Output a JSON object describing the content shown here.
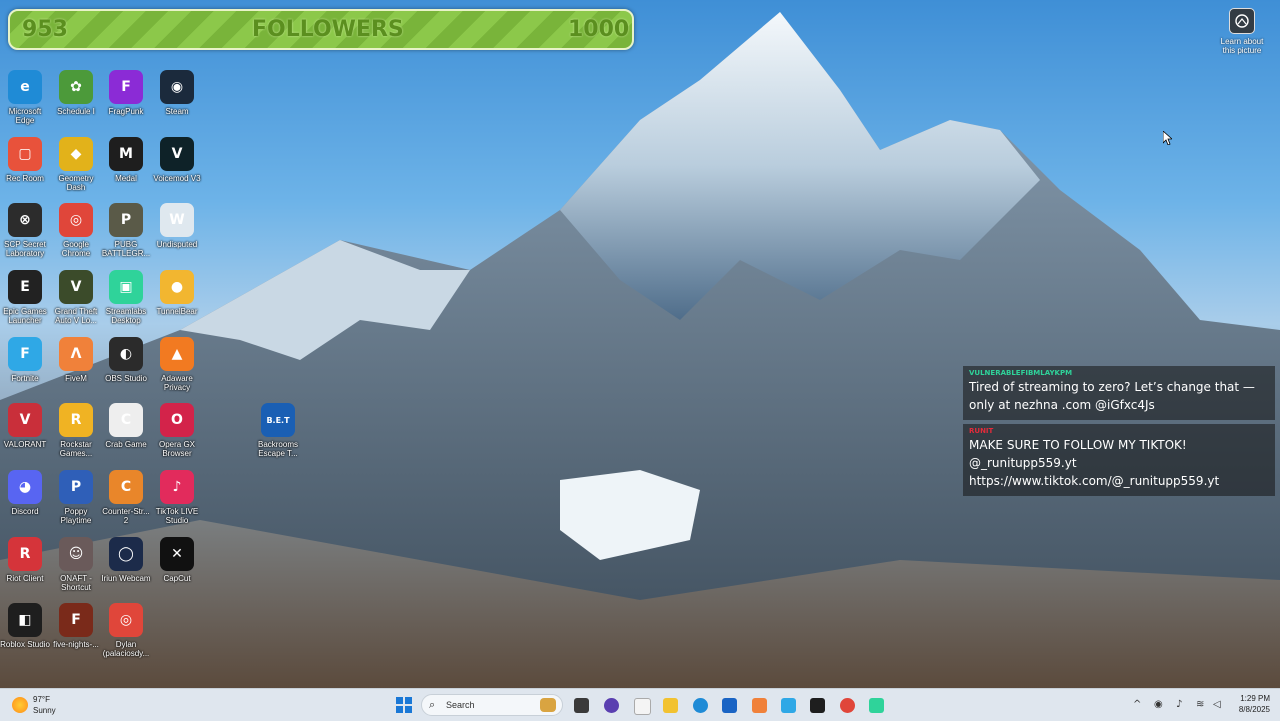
{
  "followers_goal": {
    "current": "953",
    "label": "FOLLOWERS",
    "target": "1000"
  },
  "desktop_icons": [
    {
      "name": "Microsoft Edge",
      "label": "Microsoft Edge",
      "color": "#1f8bd6",
      "glyph": "e"
    },
    {
      "name": "Schedule I",
      "label": "Schedule I",
      "color": "#4c9a3a",
      "glyph": "✿"
    },
    {
      "name": "FragPunk",
      "label": "FragPunk",
      "color": "#8b2bd6",
      "glyph": "F"
    },
    {
      "name": "Steam",
      "label": "Steam",
      "color": "#1b2a3c",
      "glyph": "◉"
    },
    {
      "name": "Rec Room",
      "label": "Rec Room",
      "color": "#e8523b",
      "glyph": "▢"
    },
    {
      "name": "Geometry Dash",
      "label": "Geometry Dash",
      "color": "#e2b21a",
      "glyph": "◆"
    },
    {
      "name": "Medal",
      "label": "Medal",
      "color": "#1e1e1e",
      "glyph": "M"
    },
    {
      "name": "Voicemod V3",
      "label": "Voicemod V3",
      "color": "#0e2228",
      "glyph": "V"
    },
    {
      "name": "SCP Secret Laboratory",
      "label": "SCP Secret Laboratory",
      "color": "#2c2c2c",
      "glyph": "⊗"
    },
    {
      "name": "Google Chrome",
      "label": "Google Chrome",
      "color": "#e0463a",
      "glyph": "◎"
    },
    {
      "name": "PUBG BATTLEGROUNDS",
      "label": "PUBG BATTLEGR...",
      "color": "#5a5a48",
      "glyph": "P"
    },
    {
      "name": "Undisputed",
      "label": "Undisputed",
      "color": "#dfe8ef",
      "glyph": "W"
    },
    {
      "name": "Epic Games Launcher",
      "label": "Epic Games Launcher",
      "color": "#222222",
      "glyph": "E"
    },
    {
      "name": "Grand Theft Auto V",
      "label": "Grand Theft Auto V Lo...",
      "color": "#3b4b2a",
      "glyph": "V"
    },
    {
      "name": "Streamlabs Desktop",
      "label": "Streamlabs Desktop",
      "color": "#2fd39a",
      "glyph": "▣"
    },
    {
      "name": "TunnelBear",
      "label": "TunnelBear",
      "color": "#f2b630",
      "glyph": "●"
    },
    {
      "name": "Fortnite",
      "label": "Fortnite",
      "color": "#2fa8e6",
      "glyph": "F"
    },
    {
      "name": "FiveM",
      "label": "FiveM",
      "color": "#f0813a",
      "glyph": "Λ"
    },
    {
      "name": "OBS Studio",
      "label": "OBS Studio",
      "color": "#2b2b2b",
      "glyph": "◐"
    },
    {
      "name": "Adaware Privacy",
      "label": "Adaware Privacy",
      "color": "#f27a21",
      "glyph": "▲"
    },
    {
      "name": "VALORANT",
      "label": "VALORANT",
      "color": "#c92f3a",
      "glyph": "V"
    },
    {
      "name": "Rockstar Games",
      "label": "Rockstar Games...",
      "color": "#f0b323",
      "glyph": "R"
    },
    {
      "name": "Crab Game",
      "label": "Crab Game",
      "color": "#eeeeee",
      "glyph": "C"
    },
    {
      "name": "Opera GX Browser",
      "label": "Opera GX Browser",
      "color": "#d3234a",
      "glyph": "O"
    },
    {
      "name": "Discord",
      "label": "Discord",
      "color": "#5865f2",
      "glyph": "◕"
    },
    {
      "name": "Poppy Playtime",
      "label": "Poppy Playtime",
      "color": "#2f5fb8",
      "glyph": "P"
    },
    {
      "name": "Counter-Strike 2",
      "label": "Counter-Str... 2",
      "color": "#e9862a",
      "glyph": "C"
    },
    {
      "name": "TikTok LIVE Studio",
      "label": "TikTok LIVE Studio",
      "color": "#e22b5c",
      "glyph": "♪"
    },
    {
      "name": "Riot Client",
      "label": "Riot Client",
      "color": "#d5343a",
      "glyph": "R"
    },
    {
      "name": "ONAFT - Shortcut",
      "label": "ONAFT - Shortcut",
      "color": "#6a5a5a",
      "glyph": "☺"
    },
    {
      "name": "Iriun Webcam",
      "label": "Iriun Webcam",
      "color": "#1c2b4a",
      "glyph": "◯"
    },
    {
      "name": "CapCut",
      "label": "CapCut",
      "color": "#111111",
      "glyph": "✕"
    },
    {
      "name": "Roblox Studio",
      "label": "Roblox Studio",
      "color": "#1e1e1e",
      "glyph": "◧"
    },
    {
      "name": "five-nights-",
      "label": "five-nights-...",
      "color": "#7a2a1a",
      "glyph": "F"
    },
    {
      "name": "Dylan (palaciosdy)",
      "label": "Dylan (palaciosdy...",
      "color": "#e0463a",
      "glyph": "◎"
    },
    {
      "name": "Backrooms Escape",
      "label": "Backrooms Escape T...",
      "color": "#1a5fb4",
      "glyph": "B.E.T"
    }
  ],
  "learn_about": {
    "label": "Learn about this picture"
  },
  "chat": [
    {
      "user": "VULNERABLEFIBMLAYKPM",
      "user_color": "#2fd39a",
      "text": "Tired of streaming to zero? Let’s change that — only at nezhna .com @iGfxc4Js"
    },
    {
      "user": "RUNIT",
      "user_color": "#e22b3a",
      "text": "MAKE SURE TO FOLLOW MY TIKTOK! @_runitupp559.yt https://www.tiktok.com/@_runitupp559.yt"
    }
  ],
  "taskbar": {
    "weather_temp": "97°F",
    "weather_desc": "Sunny",
    "search_placeholder": "Search",
    "time": "1:29 PM",
    "date": "8/8/2025"
  }
}
